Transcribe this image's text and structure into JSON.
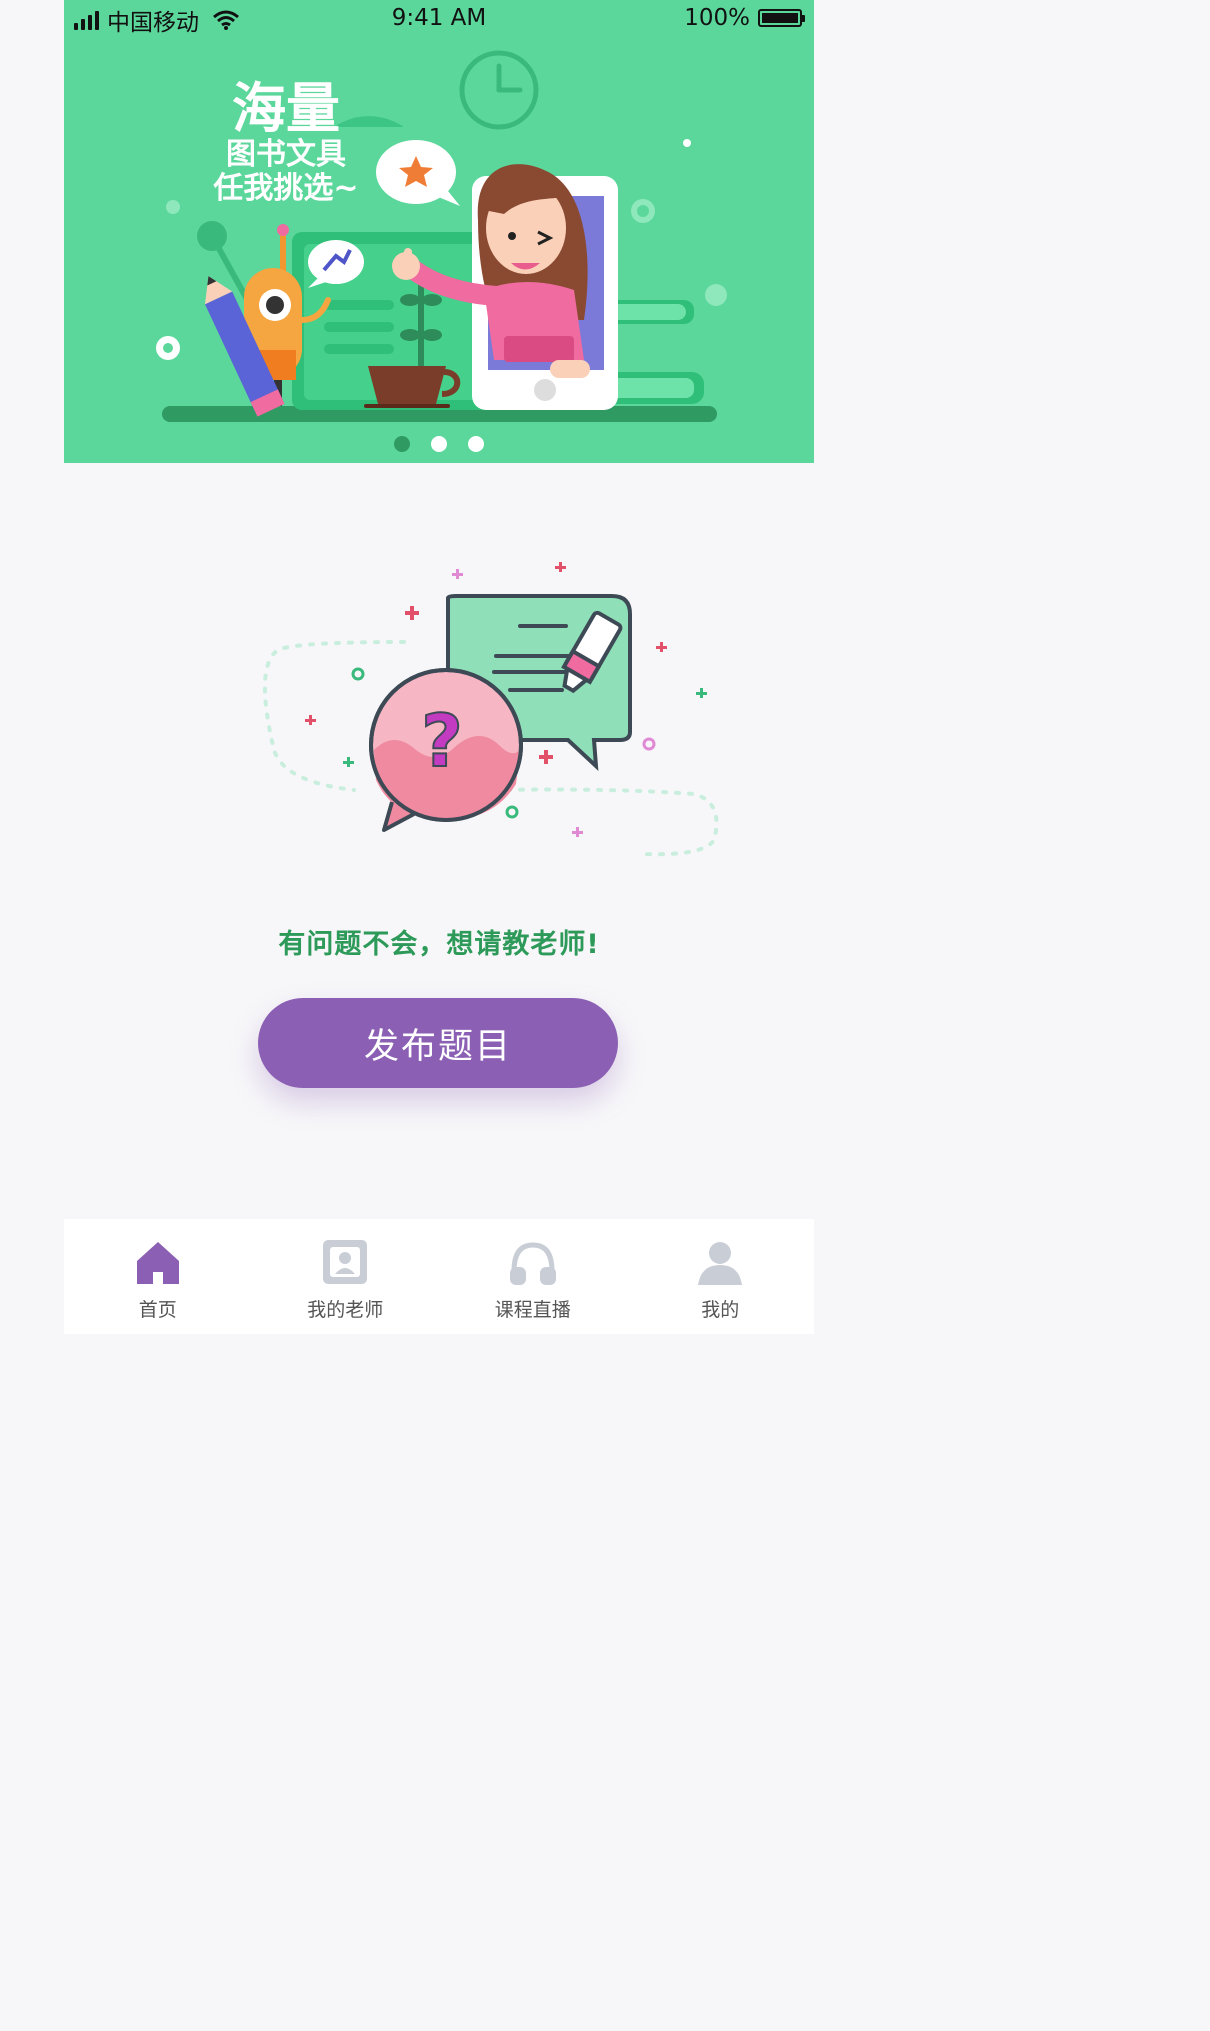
{
  "status_bar": {
    "carrier": "中国移动",
    "time": "9:41 AM",
    "battery_percent": "100%"
  },
  "banner": {
    "headline_big": "海量",
    "headline_line2": "图书文具",
    "headline_line3": "任我挑选~",
    "background_color": "#5cd79c",
    "pager_dots": 3,
    "active_dot_index": 0
  },
  "main": {
    "prompt": "有问题不会，想请教老师!",
    "publish_button": "发布题目",
    "accent_color": "#8b5fb3"
  },
  "tab_bar": {
    "tabs": [
      {
        "label": "首页",
        "icon": "home-icon",
        "active": true
      },
      {
        "label": "我的老师",
        "icon": "teacher-card-icon",
        "active": false
      },
      {
        "label": "课程直播",
        "icon": "headphones-icon",
        "active": false
      },
      {
        "label": "我的",
        "icon": "user-icon",
        "active": false
      }
    ]
  }
}
